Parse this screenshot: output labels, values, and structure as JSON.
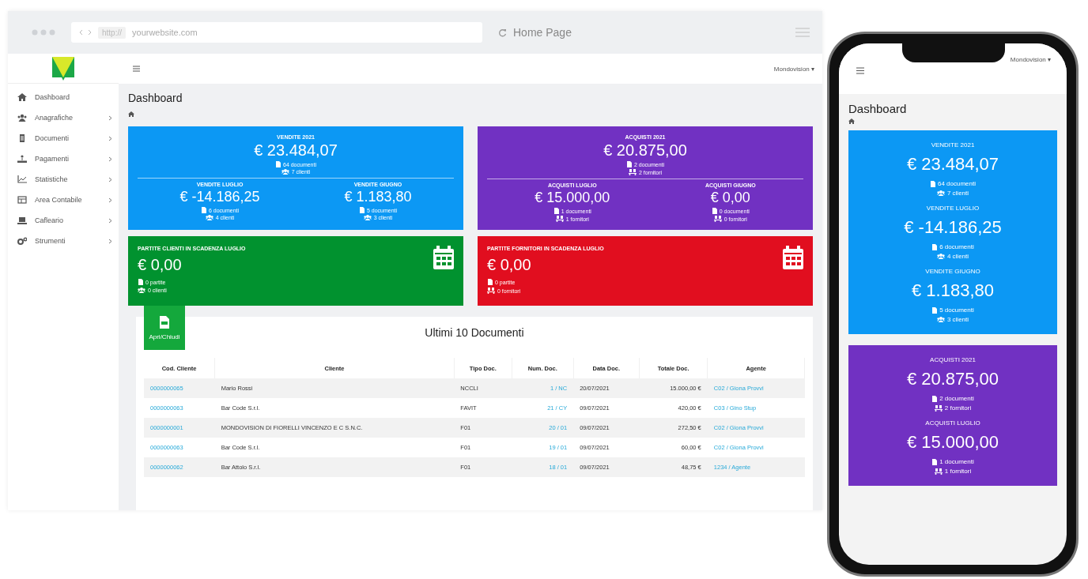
{
  "browser": {
    "url_scheme": "http://",
    "url": "yourwebsite.com",
    "page_title": "Home Page"
  },
  "app": {
    "user": "Mondovision ▾",
    "nav": [
      {
        "label": "Dashboard",
        "has_submenu": false
      },
      {
        "label": "Anagrafiche",
        "has_submenu": true
      },
      {
        "label": "Documenti",
        "has_submenu": true
      },
      {
        "label": "Pagamenti",
        "has_submenu": true
      },
      {
        "label": "Statistiche",
        "has_submenu": true
      },
      {
        "label": "Area Contabile",
        "has_submenu": true
      },
      {
        "label": "Cafleario",
        "has_submenu": true
      },
      {
        "label": "Strumenti",
        "has_submenu": true
      }
    ],
    "title": "Dashboard",
    "summary_cards": [
      {
        "color": "#0c98f4",
        "kind": "clients",
        "total": {
          "title": "VENDITE 2021",
          "amount": "€ 23.484,07",
          "docs": "64 documenti",
          "parties": "7 clienti"
        },
        "months": [
          {
            "title": "VENDITE LUGLIO",
            "amount": "€ -14.186,25",
            "docs": "6 documenti",
            "parties": "4 clienti"
          },
          {
            "title": "VENDITE GIUGNO",
            "amount": "€ 1.183,80",
            "docs": "5 documenti",
            "parties": "3 clienti"
          }
        ]
      },
      {
        "color": "#7131c2",
        "kind": "suppliers",
        "total": {
          "title": "ACQUISTI 2021",
          "amount": "€ 20.875,00",
          "docs": "2 documenti",
          "parties": "2 fornitori"
        },
        "months": [
          {
            "title": "ACQUISTI LUGLIO",
            "amount": "€ 15.000,00",
            "docs": "1 documenti",
            "parties": "1 fornitori"
          },
          {
            "title": "ACQUISTI GIUGNO",
            "amount": "€ 0,00",
            "docs": "0 documenti",
            "parties": "0 fornitori"
          }
        ]
      }
    ],
    "due_cards": [
      {
        "color": "#01922f",
        "kind": "clients",
        "title": "PARTITE CLIENTI IN SCADENZA LUGLIO",
        "amount": "€ 0,00",
        "docs": "0 partite",
        "parties": "0 clienti"
      },
      {
        "color": "#e10e1f",
        "kind": "suppliers",
        "title": "PARTITE FORNITORI IN SCADENZA LUGLIO",
        "amount": "€ 0,00",
        "docs": "0 partite",
        "parties": "0 fornitori"
      }
    ],
    "documents": {
      "toggle_label": "Apri/Chiudi",
      "title": "Ultimi 10 Documenti",
      "columns": [
        {
          "label": "Cod. Cliente",
          "kind": "link"
        },
        {
          "label": "Cliente",
          "kind": "text"
        },
        {
          "label": "Tipo Doc.",
          "kind": "text"
        },
        {
          "label": "Num. Doc.",
          "kind": "numlink"
        },
        {
          "label": "Data Doc.",
          "kind": "text"
        },
        {
          "label": "Totale Doc.",
          "kind": "amount"
        },
        {
          "label": "Agente",
          "kind": "link"
        }
      ],
      "rows": [
        [
          "0000000065",
          "Mario Rossi",
          "NCCLI",
          "1 / NC",
          "20/07/2021",
          "15.000,00 €",
          "C02 / Giona Provvi"
        ],
        [
          "0000000063",
          "Bar Code S.r.l.",
          "FAVIT",
          "21 / CY",
          "09/07/2021",
          "420,00 €",
          "C03 / Gino Stup"
        ],
        [
          "0000000001",
          "MONDOVISION DI FIORELLI VINCENZO E C S.N.C.",
          "F01",
          "20 / 01",
          "09/07/2021",
          "272,50 €",
          "C02 / Giona Provvi"
        ],
        [
          "0000000063",
          "Bar Code S.r.l.",
          "F01",
          "19 / 01",
          "09/07/2021",
          "60,00 €",
          "C02 / Giona Provvi"
        ],
        [
          "0000000062",
          "Bar Attolo S.r.l.",
          "F01",
          "18 / 01",
          "09/07/2021",
          "48,75 €",
          "1234 / Agente"
        ]
      ]
    }
  },
  "phone": {
    "user": "Mondovision ▾",
    "title": "Dashboard",
    "cards": [
      {
        "color": "#0c98f4",
        "kind": "clients",
        "sections": [
          {
            "title": "VENDITE 2021",
            "amount": "€ 23.484,07",
            "docs": "64 documenti",
            "parties": "7 clienti"
          },
          {
            "title": "VENDITE LUGLIO",
            "amount": "€ -14.186,25",
            "docs": "6 documenti",
            "parties": "4 clienti"
          },
          {
            "title": "VENDITE GIUGNO",
            "amount": "€ 1.183,80",
            "docs": "5 documenti",
            "parties": "3 clienti"
          }
        ]
      },
      {
        "color": "#7131c2",
        "kind": "suppliers",
        "sections": [
          {
            "title": "ACQUISTI 2021",
            "amount": "€ 20.875,00",
            "docs": "2 documenti",
            "parties": "2 fornitori"
          },
          {
            "title": "ACQUISTI LUGLIO",
            "amount": "€ 15.000,00",
            "docs": "1 documenti",
            "parties": "1 fornitori"
          }
        ]
      }
    ]
  }
}
